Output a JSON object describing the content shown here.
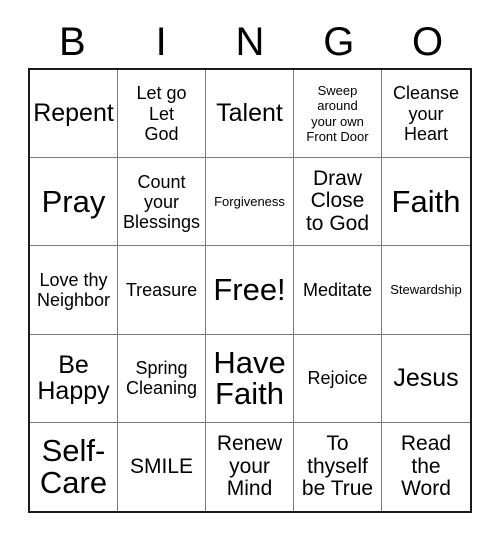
{
  "card": {
    "title_letters": [
      "B",
      "I",
      "N",
      "G",
      "O"
    ],
    "grid_size": "5x5",
    "free_space_label": "Free!",
    "colors": {
      "text": "#000000",
      "outer_border": "#1a1a1a",
      "inner_border": "#7a7a7a",
      "background": "#ffffff"
    }
  },
  "rows": [
    [
      {
        "text": "Repent",
        "size": "sz-xl"
      },
      {
        "text": "Let go\nLet\nGod",
        "size": "sz-m"
      },
      {
        "text": "Talent",
        "size": "sz-xl"
      },
      {
        "text": "Sweep\naround\nyour own\nFront Door",
        "size": "sz-xs"
      },
      {
        "text": "Cleanse\nyour\nHeart",
        "size": "sz-m"
      }
    ],
    [
      {
        "text": "Pray",
        "size": "sz-xxl"
      },
      {
        "text": "Count\nyour\nBlessings",
        "size": "sz-m"
      },
      {
        "text": "Forgiveness",
        "size": "sz-xs"
      },
      {
        "text": "Draw\nClose\nto God",
        "size": "sz-l"
      },
      {
        "text": "Faith",
        "size": "sz-xxl"
      }
    ],
    [
      {
        "text": "Love thy\nNeighbor",
        "size": "sz-m"
      },
      {
        "text": "Treasure",
        "size": "sz-m"
      },
      {
        "text": "Free!",
        "size": "sz-xxl"
      },
      {
        "text": "Meditate",
        "size": "sz-m"
      },
      {
        "text": "Stewardship",
        "size": "sz-xs"
      }
    ],
    [
      {
        "text": "Be\nHappy",
        "size": "sz-xl"
      },
      {
        "text": "Spring\nCleaning",
        "size": "sz-m"
      },
      {
        "text": "Have\nFaith",
        "size": "sz-xxl"
      },
      {
        "text": "Rejoice",
        "size": "sz-m"
      },
      {
        "text": "Jesus",
        "size": "sz-xl"
      }
    ],
    [
      {
        "text": "Self-\nCare",
        "size": "sz-xxl"
      },
      {
        "text": "SMILE",
        "size": "sz-l"
      },
      {
        "text": "Renew\nyour\nMind",
        "size": "sz-l"
      },
      {
        "text": "To\nthyself\nbe True",
        "size": "sz-l"
      },
      {
        "text": "Read\nthe\nWord",
        "size": "sz-l"
      }
    ]
  ]
}
